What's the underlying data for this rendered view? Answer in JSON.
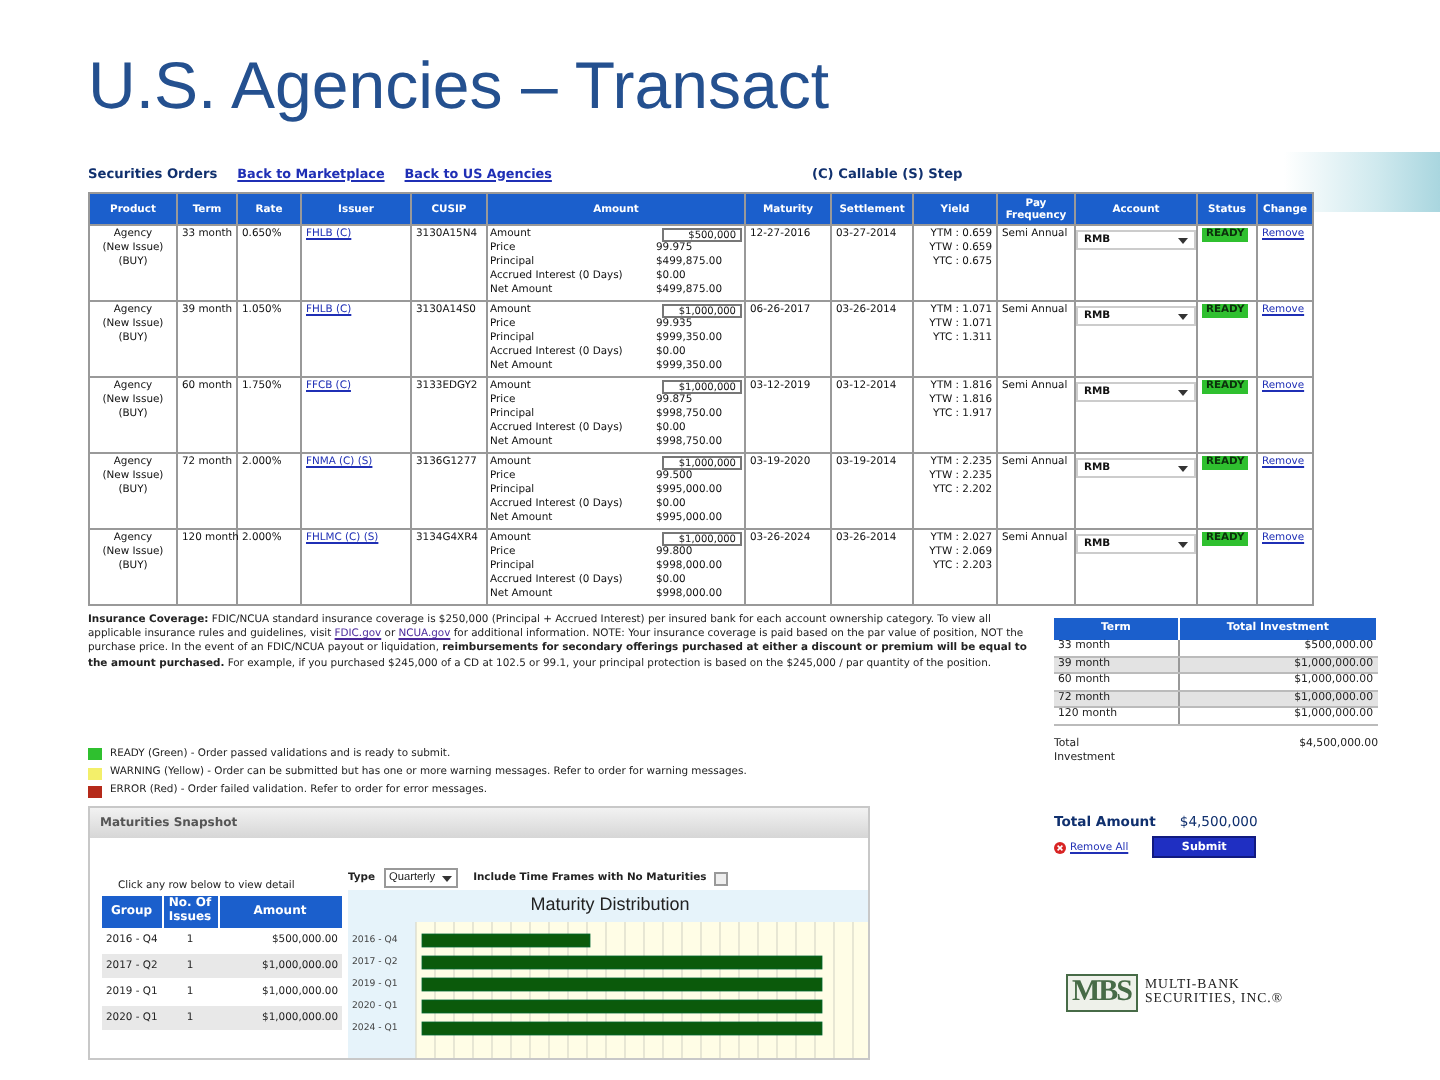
{
  "slide": {
    "title": "U.S. Agencies – Transact"
  },
  "orders": {
    "title": "Securities Orders",
    "links": [
      "Back to Marketplace",
      "Back to US Agencies"
    ],
    "key_note": "(C) Callable (S) Step",
    "columns": [
      "Product",
      "Term",
      "Rate",
      "Issuer",
      "CUSIP",
      "Amount",
      "Maturity",
      "Settlement",
      "Yield",
      "Pay Frequency",
      "Account",
      "Status",
      "Change"
    ],
    "rows": [
      {
        "product": "Agency\n(New Issue)\n(BUY)",
        "term": "33 month",
        "rate": "0.650%",
        "issuer": "FHLB (C)",
        "cusip": "3130A15N4",
        "amount": [
          {
            "kind": "input",
            "label": "Amount",
            "value": "$500,000"
          },
          {
            "kind": "text",
            "label": "Price",
            "value": "99.975"
          },
          {
            "kind": "text",
            "label": "Principal",
            "value": "$499,875.00"
          },
          {
            "kind": "text",
            "label": "Accrued Interest (0 Days)",
            "value": "$0.00"
          },
          {
            "kind": "text",
            "label": "Net Amount",
            "value": "$499,875.00"
          }
        ],
        "maturity": "12-27-2016",
        "settlement": "03-27-2014",
        "yield": [
          "YTM : 0.659",
          "YTW : 0.659",
          "YTC : 0.675"
        ],
        "frequency": "Semi Annual",
        "account": "RMB",
        "status": {
          "label": "READY",
          "color": "#2fc02f"
        },
        "action": "Remove"
      },
      {
        "product": "Agency\n(New Issue)\n(BUY)",
        "term": "39 month",
        "rate": "1.050%",
        "issuer": "FHLB (C)",
        "cusip": "3130A14S0",
        "amount": [
          {
            "kind": "input",
            "label": "Amount",
            "value": "$1,000,000"
          },
          {
            "kind": "text",
            "label": "Price",
            "value": "99.935"
          },
          {
            "kind": "text",
            "label": "Principal",
            "value": "$999,350.00"
          },
          {
            "kind": "text",
            "label": "Accrued Interest (0 Days)",
            "value": "$0.00"
          },
          {
            "kind": "text",
            "label": "Net Amount",
            "value": "$999,350.00"
          }
        ],
        "maturity": "06-26-2017",
        "settlement": "03-26-2014",
        "yield": [
          "YTM : 1.071",
          "YTW : 1.071",
          "YTC : 1.311"
        ],
        "frequency": "Semi Annual",
        "account": "RMB",
        "status": {
          "label": "READY",
          "color": "#2fc02f"
        },
        "action": "Remove"
      },
      {
        "product": "Agency\n(New Issue)\n(BUY)",
        "term": "60 month",
        "rate": "1.750%",
        "issuer": "FFCB (C)",
        "cusip": "3133EDGY2",
        "amount": [
          {
            "kind": "input",
            "label": "Amount",
            "value": "$1,000,000"
          },
          {
            "kind": "text",
            "label": "Price",
            "value": "99.875"
          },
          {
            "kind": "text",
            "label": "Principal",
            "value": "$998,750.00"
          },
          {
            "kind": "text",
            "label": "Accrued Interest (0 Days)",
            "value": "$0.00"
          },
          {
            "kind": "text",
            "label": "Net Amount",
            "value": "$998,750.00"
          }
        ],
        "maturity": "03-12-2019",
        "settlement": "03-12-2014",
        "yield": [
          "YTM : 1.816",
          "YTW : 1.816",
          "YTC : 1.917"
        ],
        "frequency": "Semi Annual",
        "account": "RMB",
        "status": {
          "label": "READY",
          "color": "#2fc02f"
        },
        "action": "Remove"
      },
      {
        "product": "Agency\n(New Issue)\n(BUY)",
        "term": "72 month",
        "rate": "2.000%",
        "issuer": "FNMA (C) (S)",
        "cusip": "3136G1277",
        "amount": [
          {
            "kind": "input",
            "label": "Amount",
            "value": "$1,000,000"
          },
          {
            "kind": "text",
            "label": "Price",
            "value": "99.500"
          },
          {
            "kind": "text",
            "label": "Principal",
            "value": "$995,000.00"
          },
          {
            "kind": "text",
            "label": "Accrued Interest (0 Days)",
            "value": "$0.00"
          },
          {
            "kind": "text",
            "label": "Net Amount",
            "value": "$995,000.00"
          }
        ],
        "maturity": "03-19-2020",
        "settlement": "03-19-2014",
        "yield": [
          "YTM : 2.235",
          "YTW : 2.235",
          "YTC : 2.202"
        ],
        "frequency": "Semi Annual",
        "account": "RMB",
        "status": {
          "label": "READY",
          "color": "#2fc02f"
        },
        "action": "Remove"
      },
      {
        "product": "Agency\n(New Issue)\n(BUY)",
        "term": "120 month",
        "rate": "2.000%",
        "issuer": "FHLMC (C) (S)",
        "cusip": "3134G4XR4",
        "amount": [
          {
            "kind": "input",
            "label": "Amount",
            "value": "$1,000,000"
          },
          {
            "kind": "text",
            "label": "Price",
            "value": "99.800"
          },
          {
            "kind": "text",
            "label": "Principal",
            "value": "$998,000.00"
          },
          {
            "kind": "text",
            "label": "Accrued Interest (0 Days)",
            "value": "$0.00"
          },
          {
            "kind": "text",
            "label": "Net Amount",
            "value": "$998,000.00"
          }
        ],
        "maturity": "03-26-2024",
        "settlement": "03-26-2014",
        "yield": [
          "YTM : 2.027",
          "YTW : 2.069",
          "YTC : 2.203"
        ],
        "frequency": "Semi Annual",
        "account": "RMB",
        "status": {
          "label": "READY",
          "color": "#2fc02f"
        },
        "action": "Remove"
      }
    ]
  },
  "insurance_note": [
    {
      "kind": "text",
      "text": "**Insurance Coverage:** FDIC/NCUA standard insurance coverage is $250,000 (Principal + Accrued Interest) per insured bank for each account ownership category. To view all applicable insurance rules and guidelines, visit "
    },
    {
      "kind": "link",
      "text": "FDIC.gov"
    },
    {
      "kind": "text",
      "text": " or "
    },
    {
      "kind": "link",
      "text": "NCUA.gov"
    },
    {
      "kind": "text",
      "text": " for additional information. NOTE: Your insurance coverage is paid based on the par value of position, NOT the purchase price. In the event of an FDIC/NCUA payout or liquidation, **reimbursements for secondary offerings purchased at either a discount or premium will be equal to the amount purchased.** For example, if you purchased $245,000 of a CD at 102.5 or 99.1, your principal protection is based on the $245,000 / par quantity of the position."
    }
  ],
  "status_legend": [
    {
      "color": "#2fc02f",
      "text": "READY (Green) - Order passed validations and is ready to submit."
    },
    {
      "color": "#f3ef6a",
      "text": "WARNING (Yellow) - Order can be submitted but has one or more warning messages. Refer to order for warning messages."
    },
    {
      "color": "#b52a1a",
      "text": "ERROR (Red) - Order failed validation. Refer to order for error messages."
    }
  ],
  "investment_summary": {
    "columns": [
      "Term",
      "Total Investment"
    ],
    "rows": [
      [
        "33 month",
        "$500,000.00"
      ],
      [
        "39 month",
        "$1,000,000.00"
      ],
      [
        "60 month",
        "$1,000,000.00"
      ],
      [
        "72 month",
        "$1,000,000.00"
      ],
      [
        "120 month",
        "$1,000,000.00"
      ]
    ],
    "total_label": "Total\nInvestment",
    "total_value": "$4,500,000.00"
  },
  "totals": {
    "label": "Total Amount",
    "value": "$4,500,000",
    "remove_all": "Remove All",
    "submit": "Submit"
  },
  "snapshot": {
    "title": "Maturities Snapshot",
    "hint": "Click any row below to view detail",
    "type_label": "Type",
    "type_value": "Quarterly",
    "include_empty": {
      "label": "Include Time Frames with No Maturities",
      "checked": false
    },
    "columns": [
      "Group",
      "No. Of Issues",
      "Amount"
    ],
    "rows": [
      [
        "2016 - Q4",
        "1",
        "$500,000.00"
      ],
      [
        "2017 - Q2",
        "1",
        "$1,000,000.00"
      ],
      [
        "2019 - Q1",
        "1",
        "$1,000,000.00"
      ],
      [
        "2020 - Q1",
        "1",
        "$1,000,000.00"
      ]
    ],
    "chart_title": "Maturity Distribution",
    "chart_labels": [
      "2016 - Q4",
      "2017 - Q2",
      "2019 - Q1",
      "2020 - Q1",
      "2024 - Q1"
    ]
  },
  "logo": {
    "monogram": "MBS",
    "name": "MULTI-BANK\nSECURITIES, INC.®"
  }
}
